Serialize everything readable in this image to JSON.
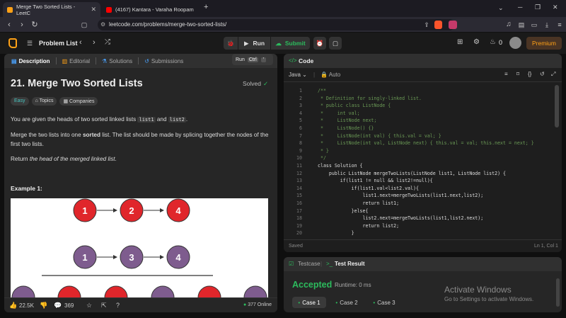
{
  "browser": {
    "tabs": [
      {
        "title": "Merge Two Sorted Lists - LeetC",
        "active": true
      },
      {
        "title": "(4167) Kantara - Varaha Roopam",
        "active": false
      }
    ],
    "new_tab": "+",
    "url": "leetcode.com/problems/merge-two-sorted-lists/",
    "min": "─",
    "max": "❐",
    "close": "✕"
  },
  "lc": {
    "problem_list": "Problem List",
    "run": "Run",
    "submit": "Submit",
    "streak": "0",
    "premium": "Premium",
    "tooltip": {
      "label": "Run",
      "key1": "Ctrl",
      "key2": "'"
    }
  },
  "left": {
    "tabs": [
      "Description",
      "Editorial",
      "Solutions",
      "Submissions"
    ],
    "title": "21. Merge Two Sorted Lists",
    "solved": "Solved",
    "tags": [
      "Easy",
      "Topics",
      "Companies"
    ],
    "p1a": "You are given the heads of two sorted linked lists ",
    "p1code1": "list1",
    "p1b": " and ",
    "p1code2": "list2",
    "p1c": ".",
    "p2a": "Merge the two lists into one ",
    "p2b": "sorted",
    "p2c": " list. The list should be made by splicing together the nodes of the first two lists.",
    "p3a": "Return ",
    "p3b": "the head of the merged linked list",
    "p3c": ".",
    "example": "Example 1:",
    "diagram": {
      "row1": [
        "1",
        "2",
        "4"
      ],
      "row2": [
        "1",
        "3",
        "4"
      ]
    },
    "likes": "22.5K",
    "comments": "369",
    "online": "377 Online"
  },
  "right": {
    "title": "Code",
    "lang": "Java",
    "auto": "Auto",
    "saved": "Saved",
    "pos": "Ln 1, Col 1",
    "testcase": "Testcase",
    "test_result": "Test Result",
    "accepted": "Accepted",
    "runtime": "Runtime: 0 ms",
    "cases": [
      "Case 1",
      "Case 2",
      "Case 3"
    ],
    "watermark1": "Activate Windows",
    "watermark2": "Go to Settings to activate Windows."
  },
  "code_lines": [
    "/**",
    " * Definition for singly-linked list.",
    " * public class ListNode {",
    " *     int val;",
    " *     ListNode next;",
    " *     ListNode() {}",
    " *     ListNode(int val) { this.val = val; }",
    " *     ListNode(int val, ListNode next) { this.val = val; this.next = next; }",
    " * }",
    " */",
    "class Solution {",
    "    public ListNode mergeTwoLists(ListNode list1, ListNode list2) {",
    "        if(list1 != null && list2!=null){",
    "            if(list1.val<list2.val){",
    "                list1.next=mergeTwoLists(list1.next,list2);",
    "                return list1;",
    "            }else{",
    "                list2.next=mergeTwoLists(list1,list2.next);",
    "                return list2;",
    "            }"
  ],
  "colors": {
    "accent": "#ffa116",
    "green": "#2cbb5d",
    "red_node": "#e0262b",
    "purple_node": "#7e5c8e"
  }
}
